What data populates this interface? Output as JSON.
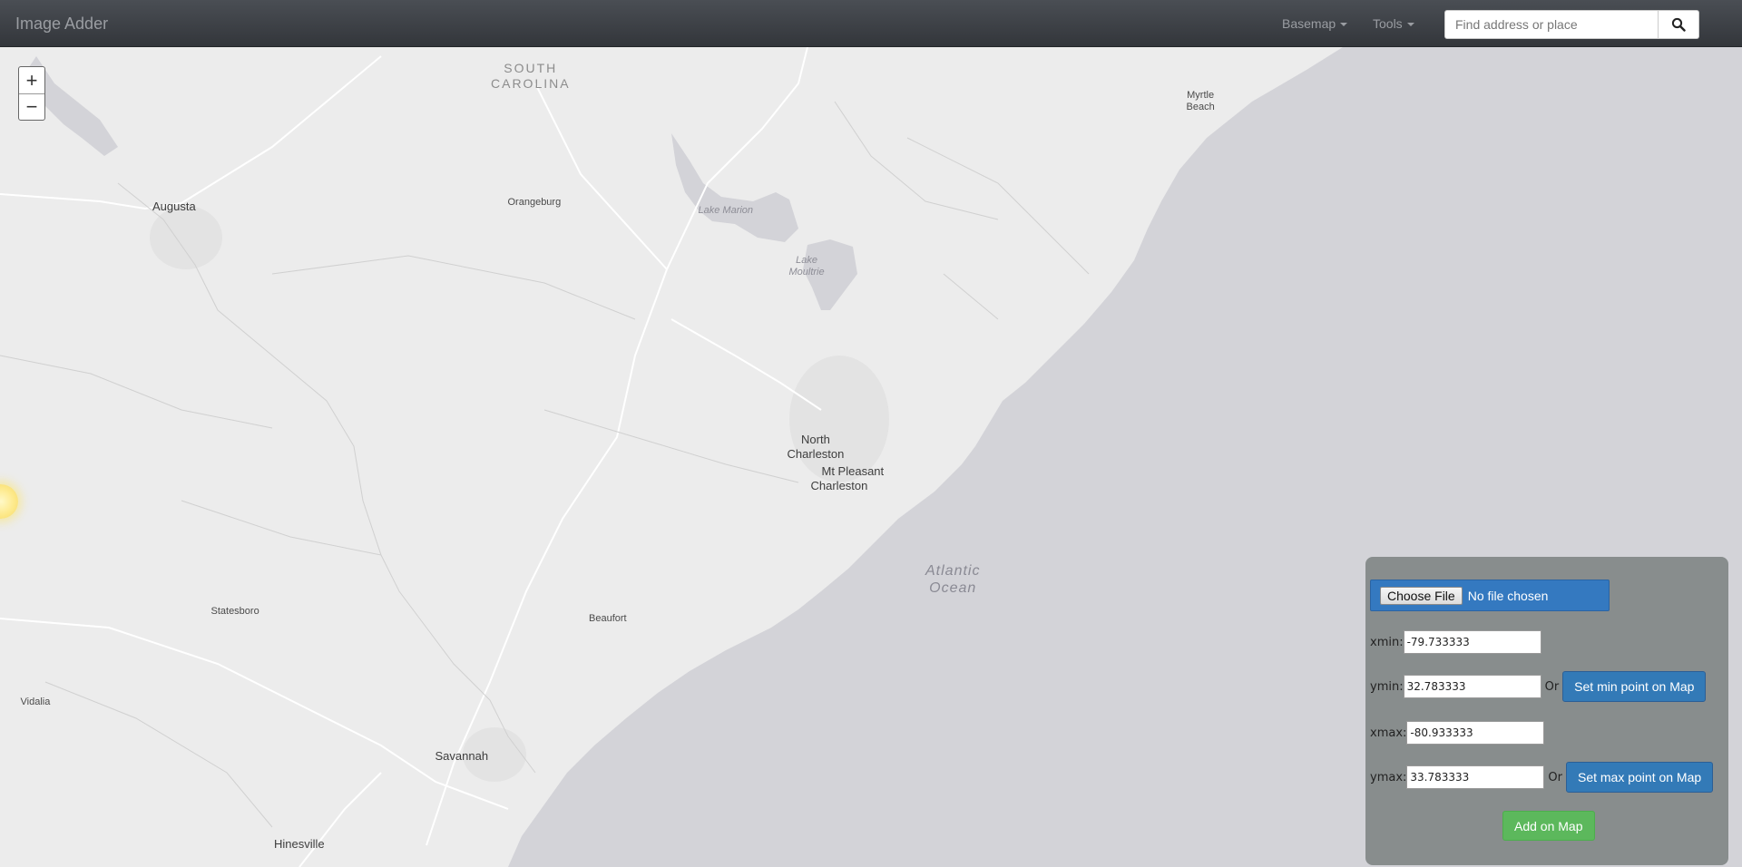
{
  "app": {
    "title": "Image Adder"
  },
  "navbar": {
    "basemap_label": "Basemap",
    "tools_label": "Tools",
    "search_placeholder": "Find address or place",
    "search_icon": "search-icon"
  },
  "map": {
    "zoom_in_label": "+",
    "zoom_out_label": "−",
    "colors": {
      "land": "#ececec",
      "water": "#d3d3d8",
      "roads": "#ffffff",
      "borders": "#d0d0d0"
    },
    "labels": {
      "state": "SOUTH\nCAROLINA",
      "myrtle_beach": "Myrtle\nBeach",
      "augusta": "Augusta",
      "orangeburg": "Orangeburg",
      "lake_marion": "Lake Marion",
      "lake_moultrie": "Lake\nMoultrie",
      "north_charleston": "North\nCharleston",
      "mt_pleasant": "Mt Pleasant",
      "charleston": "Charleston",
      "atlantic_ocean": "Atlantic\nOcean",
      "statesboro": "Statesboro",
      "beaufort": "Beaufort",
      "vidalia": "Vidalia",
      "savannah": "Savannah",
      "hinesville": "Hinesville"
    }
  },
  "panel": {
    "choose_file_label": "Choose File",
    "file_status": "No file chosen",
    "xmin_label": "xmin:",
    "xmin_value": "-79.733333",
    "ymin_label": "ymin:",
    "ymin_value": "32.783333",
    "xmax_label": "xmax:",
    "xmax_value": "-80.933333",
    "ymax_label": "ymax:",
    "ymax_value": "33.783333",
    "or_label": "Or",
    "set_min_label": "Set min point on Map",
    "set_max_label": "Set max point on Map",
    "add_label": "Add on Map"
  }
}
